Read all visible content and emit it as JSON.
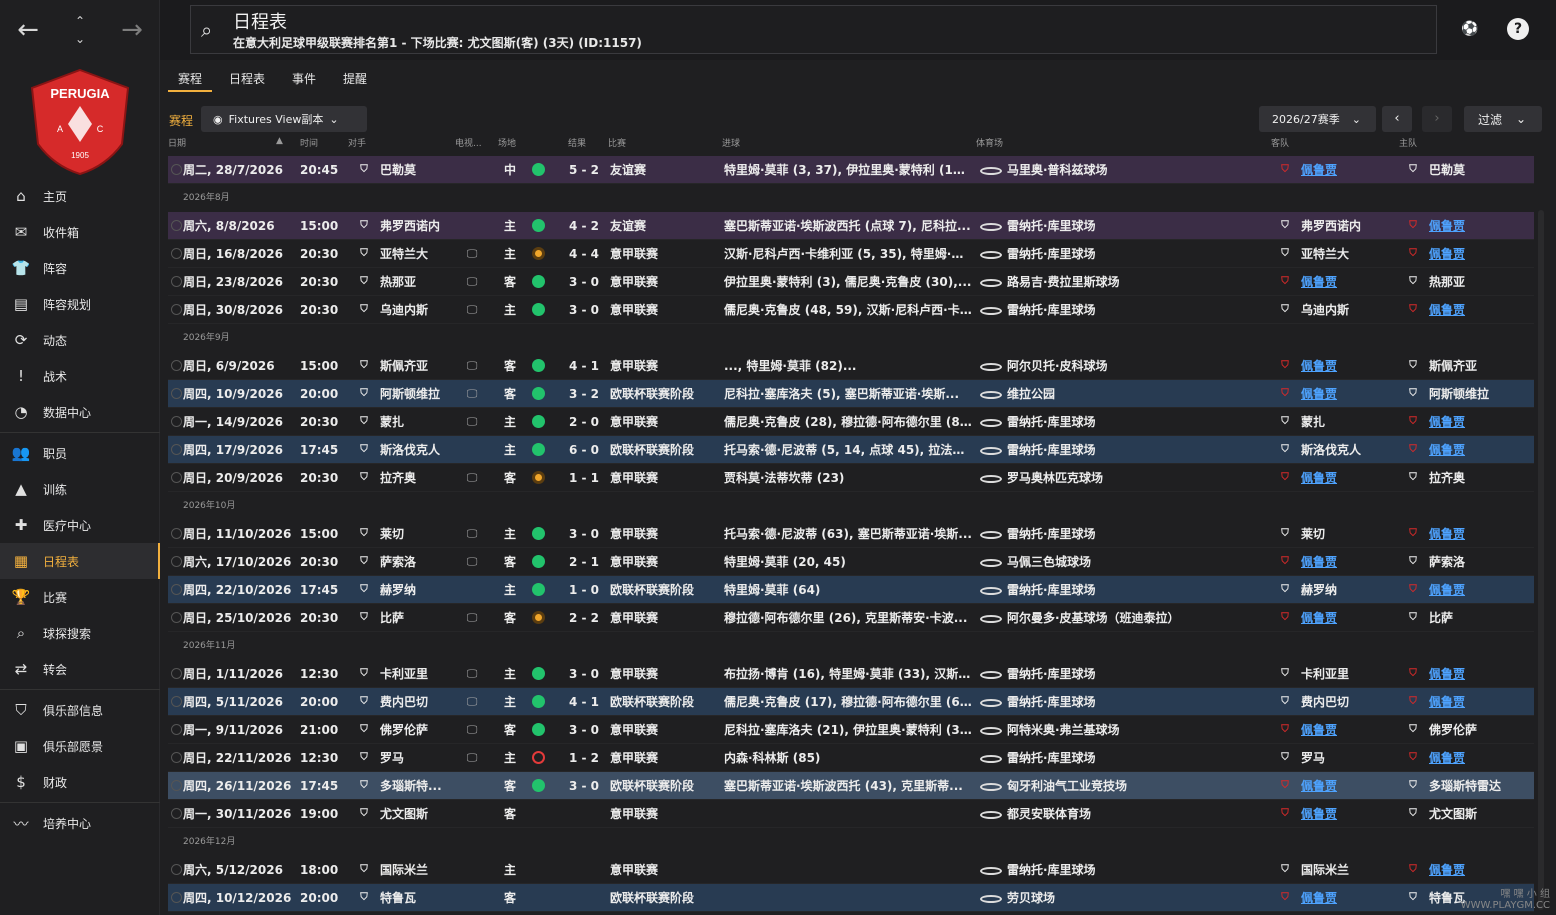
{
  "header": {
    "title": "日程表",
    "subtitle": "在意大利足球甲级联赛排名第1 - 下场比赛: 尤文图斯(客) (3天) (ID:1157)"
  },
  "club": {
    "badge_text": "PERUGIA",
    "badge_a": "A",
    "badge_c": "C",
    "badge_year": "1905",
    "color": "#d62a2a"
  },
  "sidebar": {
    "items": [
      {
        "label": "主页",
        "icon": "home-icon",
        "glyph": "⌂"
      },
      {
        "label": "收件箱",
        "icon": "inbox-icon",
        "glyph": "✉"
      },
      {
        "label": "阵容",
        "icon": "shirt-icon",
        "glyph": "👕"
      },
      {
        "label": "阵容规划",
        "icon": "clipboard-icon",
        "glyph": "▤"
      },
      {
        "label": "动态",
        "icon": "dynamics-icon",
        "glyph": "⟳"
      },
      {
        "label": "战术",
        "icon": "tactics-icon",
        "glyph": "!"
      },
      {
        "label": "数据中心",
        "icon": "data-hub-icon",
        "glyph": "◔"
      },
      {
        "label": "职员",
        "icon": "staff-icon",
        "glyph": "👥"
      },
      {
        "label": "训练",
        "icon": "training-icon",
        "glyph": "▲"
      },
      {
        "label": "医疗中心",
        "icon": "medical-icon",
        "glyph": "✚"
      },
      {
        "label": "日程表",
        "icon": "calendar-icon",
        "glyph": "▦"
      },
      {
        "label": "比赛",
        "icon": "trophy-icon",
        "glyph": "🏆"
      },
      {
        "label": "球探搜索",
        "icon": "scouting-icon",
        "glyph": "⌕"
      },
      {
        "label": "转会",
        "icon": "transfer-icon",
        "glyph": "⇄"
      },
      {
        "label": "俱乐部信息",
        "icon": "club-info-icon",
        "glyph": "⛉"
      },
      {
        "label": "俱乐部愿景",
        "icon": "club-vision-icon",
        "glyph": "▣"
      },
      {
        "label": "财政",
        "icon": "finance-icon",
        "glyph": "$"
      },
      {
        "label": "培养中心",
        "icon": "development-icon",
        "glyph": "〰"
      }
    ]
  },
  "tabs": [
    "赛程",
    "日程表",
    "事件",
    "提醒"
  ],
  "toolbar": {
    "section_label": "赛程",
    "view_label": "Fixtures View副本",
    "season_label": "2026/27赛季",
    "filter_label": "过滤"
  },
  "columns": {
    "date": "日期",
    "time": "时间",
    "opponent": "对手",
    "tv": "电视...",
    "venue": "场地",
    "result": "结果",
    "competition": "比赛",
    "goals": "进球",
    "stadium": "体育场",
    "away": "客队",
    "home": "主队"
  },
  "fixtures": [
    {
      "type": "friendly",
      "date": "周二, 28/7/2026",
      "time": "20:45",
      "opp": "巴勒莫",
      "tv": false,
      "venue": "中",
      "outcome": "win",
      "result": "5 - 2",
      "comp": "友谊赛",
      "goals": "特里姆·莫菲 (3, 37), 伊拉里奥·蒙特利 (13),...",
      "stadium": "马里奥·普科兹球场",
      "home": "巴勒莫",
      "away": "佩鲁贾",
      "home_is_us": false
    },
    {
      "month": "2026年8月"
    },
    {
      "type": "friendly",
      "date": "周六, 8/8/2026",
      "time": "15:00",
      "opp": "弗罗西诺内",
      "tv": false,
      "venue": "主",
      "outcome": "win",
      "result": "4 - 2",
      "comp": "友谊赛",
      "goals": "塞巴斯蒂亚诺·埃斯波西托 (点球 7), 尼科拉...",
      "stadium": "雷纳托·库里球场",
      "home": "佩鲁贾",
      "away": "弗罗西诺内",
      "home_is_us": true
    },
    {
      "type": "league",
      "date": "周日, 16/8/2026",
      "time": "20:30",
      "opp": "亚特兰大",
      "tv": true,
      "venue": "主",
      "outcome": "draw",
      "result": "4 - 4",
      "comp": "意甲联赛",
      "goals": "汉斯·尼科卢西·卡维利亚 (5, 35), 特里姆·莫...",
      "stadium": "雷纳托·库里球场",
      "home": "佩鲁贾",
      "away": "亚特兰大",
      "home_is_us": true
    },
    {
      "type": "league",
      "date": "周日, 23/8/2026",
      "time": "20:30",
      "opp": "热那亚",
      "tv": true,
      "venue": "客",
      "outcome": "win",
      "result": "3 - 0",
      "comp": "意甲联赛",
      "goals": "伊拉里奥·蒙特利 (3), 儒尼奥·克鲁皮 (30),...",
      "stadium": "路易吉·费拉里斯球场",
      "home": "热那亚",
      "away": "佩鲁贾",
      "home_is_us": false
    },
    {
      "type": "league",
      "date": "周日, 30/8/2026",
      "time": "20:30",
      "opp": "乌迪内斯",
      "tv": true,
      "venue": "主",
      "outcome": "win",
      "result": "3 - 0",
      "comp": "意甲联赛",
      "goals": "儒尼奥·克鲁皮 (48, 59), 汉斯·尼科卢西·卡...",
      "stadium": "雷纳托·库里球场",
      "home": "佩鲁贾",
      "away": "乌迪内斯",
      "home_is_us": true
    },
    {
      "month": "2026年9月"
    },
    {
      "type": "league",
      "date": "周日, 6/9/2026",
      "time": "15:00",
      "opp": "斯佩齐亚",
      "tv": true,
      "venue": "客",
      "outcome": "win",
      "result": "4 - 1",
      "comp": "意甲联赛",
      "goals": "..., 特里姆·莫菲 (82)...",
      "stadium": "阿尔贝托·皮科球场",
      "home": "斯佩齐亚",
      "away": "佩鲁贾",
      "home_is_us": false
    },
    {
      "type": "euro",
      "date": "周四, 10/9/2026",
      "time": "20:00",
      "opp": "阿斯顿维拉",
      "tv": true,
      "venue": "客",
      "outcome": "win",
      "result": "3 - 2",
      "comp": "欧联杯联赛阶段",
      "goals": "尼科拉·塞库洛夫 (5), 塞巴斯蒂亚诺·埃斯...",
      "stadium": "维拉公园",
      "home": "阿斯顿维拉",
      "away": "佩鲁贾",
      "home_is_us": false
    },
    {
      "type": "league",
      "date": "周一, 14/9/2026",
      "time": "20:30",
      "opp": "蒙扎",
      "tv": true,
      "venue": "主",
      "outcome": "win",
      "result": "2 - 0",
      "comp": "意甲联赛",
      "goals": "儒尼奥·克鲁皮 (28), 穆拉德·阿布德尔里 (8...",
      "stadium": "雷纳托·库里球场",
      "home": "佩鲁贾",
      "away": "蒙扎",
      "home_is_us": true
    },
    {
      "type": "euro",
      "date": "周四, 17/9/2026",
      "time": "17:45",
      "opp": "斯洛伐克人",
      "tv": false,
      "venue": "主",
      "outcome": "win",
      "result": "6 - 0",
      "comp": "欧联杯联赛阶段",
      "goals": "托马索·德·尼波蒂 (5, 14, 点球 45), 拉法埃...",
      "stadium": "雷纳托·库里球场",
      "home": "佩鲁贾",
      "away": "斯洛伐克人",
      "home_is_us": true
    },
    {
      "type": "league",
      "date": "周日, 20/9/2026",
      "time": "20:30",
      "opp": "拉齐奥",
      "tv": true,
      "venue": "客",
      "outcome": "draw",
      "result": "1 - 1",
      "comp": "意甲联赛",
      "goals": "贾科莫·法蒂坎蒂 (23)",
      "stadium": "罗马奥林匹克球场",
      "home": "拉齐奥",
      "away": "佩鲁贾",
      "home_is_us": false
    },
    {
      "month": "2026年10月"
    },
    {
      "type": "league",
      "date": "周日, 11/10/2026",
      "time": "15:00",
      "opp": "莱切",
      "tv": true,
      "venue": "主",
      "outcome": "win",
      "result": "3 - 0",
      "comp": "意甲联赛",
      "goals": "托马索·德·尼波蒂 (63), 塞巴斯蒂亚诺·埃斯...",
      "stadium": "雷纳托·库里球场",
      "home": "佩鲁贾",
      "away": "莱切",
      "home_is_us": true
    },
    {
      "type": "league",
      "date": "周六, 17/10/2026",
      "time": "20:30",
      "opp": "萨索洛",
      "tv": true,
      "venue": "客",
      "outcome": "win",
      "result": "2 - 1",
      "comp": "意甲联赛",
      "goals": "特里姆·莫菲 (20, 45)",
      "stadium": "马佩三色城球场",
      "home": "萨索洛",
      "away": "佩鲁贾",
      "home_is_us": false
    },
    {
      "type": "euro",
      "date": "周四, 22/10/2026",
      "time": "17:45",
      "opp": "赫罗纳",
      "tv": false,
      "venue": "主",
      "outcome": "win",
      "result": "1 - 0",
      "comp": "欧联杯联赛阶段",
      "goals": "特里姆·莫菲 (64)",
      "stadium": "雷纳托·库里球场",
      "home": "佩鲁贾",
      "away": "赫罗纳",
      "home_is_us": true
    },
    {
      "type": "league",
      "date": "周日, 25/10/2026",
      "time": "20:30",
      "opp": "比萨",
      "tv": true,
      "venue": "客",
      "outcome": "draw",
      "result": "2 - 2",
      "comp": "意甲联赛",
      "goals": "穆拉德·阿布德尔里 (26), 克里斯蒂安·卡波...",
      "stadium": "阿尔曼多·皮基球场（班迪泰拉）",
      "home": "比萨",
      "away": "佩鲁贾",
      "home_is_us": false
    },
    {
      "month": "2026年11月"
    },
    {
      "type": "league",
      "date": "周日, 1/11/2026",
      "time": "12:30",
      "opp": "卡利亚里",
      "tv": true,
      "venue": "主",
      "outcome": "win",
      "result": "3 - 0",
      "comp": "意甲联赛",
      "goals": "布拉扬·博肯 (16), 特里姆·莫菲 (33), 汉斯·...",
      "stadium": "雷纳托·库里球场",
      "home": "佩鲁贾",
      "away": "卡利亚里",
      "home_is_us": true
    },
    {
      "type": "euro",
      "date": "周四, 5/11/2026",
      "time": "20:00",
      "opp": "费内巴切",
      "tv": true,
      "venue": "主",
      "outcome": "win",
      "result": "4 - 1",
      "comp": "欧联杯联赛阶段",
      "goals": "儒尼奥·克鲁皮 (17), 穆拉德·阿布德尔里 (6...",
      "stadium": "雷纳托·库里球场",
      "home": "佩鲁贾",
      "away": "费内巴切",
      "home_is_us": true
    },
    {
      "type": "league",
      "date": "周一, 9/11/2026",
      "time": "21:00",
      "opp": "佛罗伦萨",
      "tv": true,
      "venue": "客",
      "outcome": "win",
      "result": "3 - 0",
      "comp": "意甲联赛",
      "goals": "尼科拉·塞库洛夫 (21), 伊拉里奥·蒙特利 (3...",
      "stadium": "阿特米奥·弗兰基球场",
      "home": "佛罗伦萨",
      "away": "佩鲁贾",
      "home_is_us": false
    },
    {
      "type": "league",
      "date": "周日, 22/11/2026",
      "time": "12:30",
      "opp": "罗马",
      "tv": true,
      "venue": "主",
      "outcome": "loss",
      "result": "1 - 2",
      "comp": "意甲联赛",
      "goals": "内森·科林斯 (85)",
      "stadium": "雷纳托·库里球场",
      "home": "佩鲁贾",
      "away": "罗马",
      "home_is_us": true
    },
    {
      "type": "sel",
      "date": "周四, 26/11/2026",
      "time": "17:45",
      "opp": "多瑙斯特...",
      "tv": false,
      "venue": "客",
      "outcome": "win",
      "result": "3 - 0",
      "comp": "欧联杯联赛阶段",
      "goals": "塞巴斯蒂亚诺·埃斯波西托 (43), 克里斯蒂...",
      "stadium": "匈牙利油气工业竞技场",
      "home": "多瑙斯特雷达",
      "away": "佩鲁贾",
      "home_is_us": false
    },
    {
      "type": "league",
      "date": "周一, 30/11/2026",
      "time": "19:00",
      "opp": "尤文图斯",
      "tv": false,
      "venue": "客",
      "outcome": "",
      "result": "",
      "comp": "意甲联赛",
      "goals": "",
      "stadium": "都灵安联体育场",
      "home": "尤文图斯",
      "away": "佩鲁贾",
      "home_is_us": false
    },
    {
      "month": "2026年12月"
    },
    {
      "type": "league",
      "date": "周六, 5/12/2026",
      "time": "18:00",
      "opp": "国际米兰",
      "tv": false,
      "venue": "主",
      "outcome": "",
      "result": "",
      "comp": "意甲联赛",
      "goals": "",
      "stadium": "雷纳托·库里球场",
      "home": "佩鲁贾",
      "away": "国际米兰",
      "home_is_us": true
    },
    {
      "type": "euro",
      "date": "周四, 10/12/2026",
      "time": "20:00",
      "opp": "特鲁瓦",
      "tv": false,
      "venue": "客",
      "outcome": "",
      "result": "",
      "comp": "欧联杯联赛阶段",
      "goals": "",
      "stadium": "劳贝球场",
      "home": "特鲁瓦",
      "away": "佩鲁贾",
      "home_is_us": false
    }
  ],
  "watermark": "嘿 嘿 小 组\nWWW.PLAYGM.CC"
}
